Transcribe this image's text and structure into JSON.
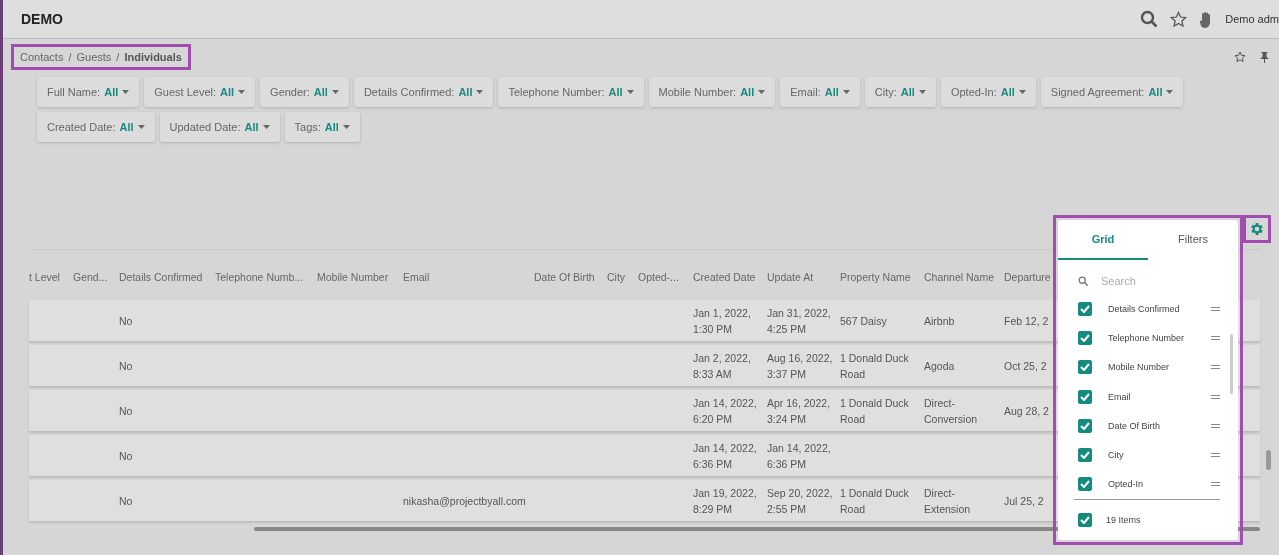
{
  "app": {
    "title": "DEMO",
    "user": "Demo adm"
  },
  "breadcrumb": {
    "separator": "/",
    "items": [
      {
        "label": "Contacts",
        "current": false
      },
      {
        "label": "Guests",
        "current": false
      },
      {
        "label": "Individuals",
        "current": true
      }
    ]
  },
  "filters": [
    {
      "label": "Full Name:",
      "value": "All"
    },
    {
      "label": "Guest Level:",
      "value": "All"
    },
    {
      "label": "Gender:",
      "value": "All"
    },
    {
      "label": "Details Confirmed:",
      "value": "All"
    },
    {
      "label": "Telephone Number:",
      "value": "All"
    },
    {
      "label": "Mobile Number:",
      "value": "All"
    },
    {
      "label": "Email:",
      "value": "All"
    },
    {
      "label": "City:",
      "value": "All"
    },
    {
      "label": "Opted-In:",
      "value": "All"
    },
    {
      "label": "Signed Agreement:",
      "value": "All"
    },
    {
      "label": "Created Date:",
      "value": "All"
    },
    {
      "label": "Updated Date:",
      "value": "All"
    },
    {
      "label": "Tags:",
      "value": "All"
    }
  ],
  "table": {
    "columns": [
      "t Level",
      "Gend...",
      "Details Confirmed",
      "Telephone Numb...",
      "Mobile Number",
      "Email",
      "Date Of Birth",
      "City",
      "Opted-...",
      "Created Date",
      "Update At",
      "Property Name",
      "Channel Name",
      "Departure"
    ],
    "rows": [
      {
        "cells": [
          null,
          null,
          "No",
          null,
          null,
          null,
          null,
          null,
          null,
          "Jan 1, 2022,\n1:30 PM",
          "Jan 31, 2022,\n4:25 PM",
          "567 Daisy",
          "Airbnb",
          "Feb 12, 2"
        ]
      },
      {
        "cells": [
          null,
          null,
          "No",
          null,
          null,
          null,
          null,
          null,
          null,
          "Jan 2, 2022,\n8:33 AM",
          "Aug 16, 2022,\n3:37 PM",
          "1 Donald Duck\nRoad",
          "Agoda",
          "Oct 25, 2"
        ]
      },
      {
        "cells": [
          null,
          null,
          "No",
          null,
          null,
          null,
          null,
          null,
          null,
          "Jan 14, 2022,\n6:20 PM",
          "Apr 16, 2022,\n3:24 PM",
          "1 Donald Duck\nRoad",
          "Direct-\nConversion",
          "Aug 28, 2"
        ]
      },
      {
        "cells": [
          null,
          null,
          "No",
          null,
          null,
          null,
          null,
          null,
          null,
          "Jan 14, 2022,\n6:36 PM",
          "Jan 14, 2022,\n6:36 PM",
          null,
          null,
          null
        ]
      },
      {
        "cells": [
          null,
          null,
          "No",
          null,
          null,
          "nikasha@projectbyall.com",
          null,
          null,
          null,
          "Jan 19, 2022,\n8:29 PM",
          "Sep 20, 2022,\n2:55 PM",
          "1 Donald Duck\nRoad",
          "Direct-\nExtension",
          "Jul 25, 2"
        ]
      }
    ]
  },
  "column_panel": {
    "tabs": [
      {
        "label": "Grid",
        "selected": true
      },
      {
        "label": "Filters",
        "selected": false
      }
    ],
    "search": {
      "placeholder": "Search"
    },
    "items": [
      {
        "label": "Details Confirmed",
        "checked": true
      },
      {
        "label": "Telephone Number",
        "checked": true
      },
      {
        "label": "Mobile Number",
        "checked": true
      },
      {
        "label": "Email",
        "checked": true
      },
      {
        "label": "Date Of Birth",
        "checked": true
      },
      {
        "label": "City",
        "checked": true
      },
      {
        "label": "Opted-In",
        "checked": true
      }
    ],
    "footer": {
      "label": "19 Items",
      "checked": true
    }
  }
}
